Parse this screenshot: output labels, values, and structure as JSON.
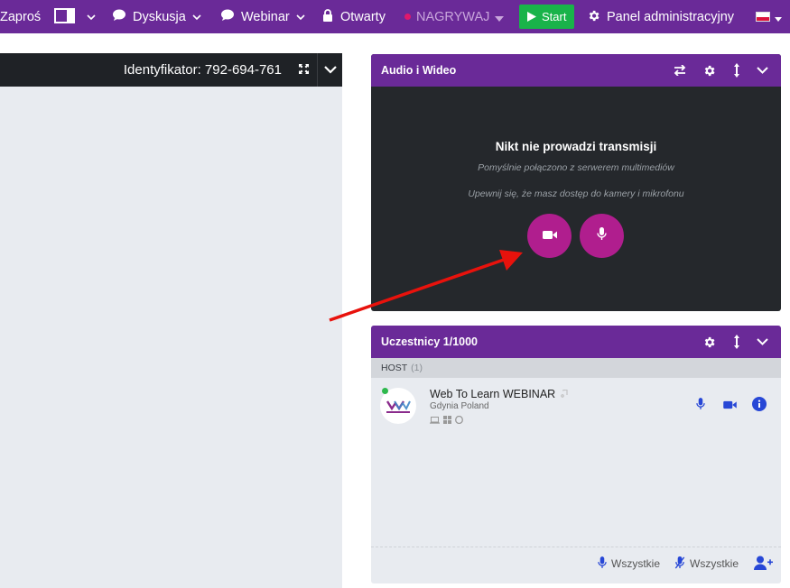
{
  "topbar": {
    "invite_label": "Zaproś",
    "discussion_label": "Dyskusja",
    "webinar_label": "Webinar",
    "open_label": "Otwarty",
    "record_label": "NAGRYWAJ",
    "start_label": "Start",
    "admin_label": "Panel administracyjny",
    "accent": "#6a2a98",
    "start_color": "#19b34a"
  },
  "left": {
    "id_label": "Identyfikator: 792-694-761"
  },
  "av_panel": {
    "title": "Audio i Wideo",
    "message": "Nikt nie prowadzi transmisji",
    "sub1": "Pomyślnie połączono z serwerem multimediów",
    "sub2": "Upewnij się, że masz dostęp do kamery i mikrofonu",
    "button_color": "#b01e8e"
  },
  "participants_panel": {
    "title": "Uczestnicy 1/1000",
    "host_label": "HOST",
    "host_count": "(1)",
    "participant": {
      "name": "Web To Learn WEBINAR",
      "location": "Gdynia Poland",
      "avatar_text": "WebToLearn"
    },
    "footer": {
      "unmute_all": "Wszystkie",
      "mute_all": "Wszystkie"
    }
  }
}
